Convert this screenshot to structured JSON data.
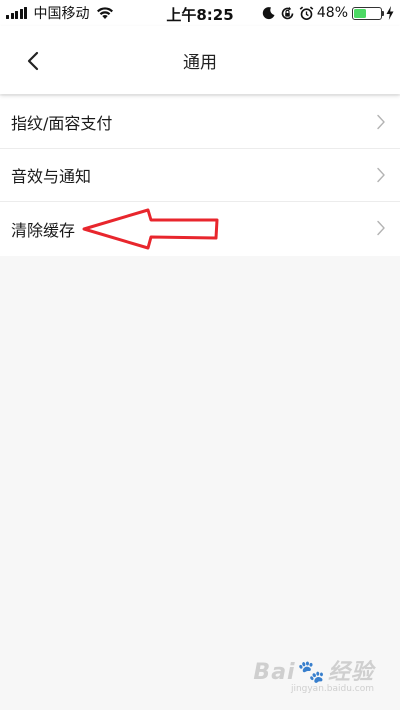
{
  "status_bar": {
    "carrier": "中国移动",
    "time": "上午8:25",
    "battery_percent": "48%",
    "battery_level": 0.48,
    "icons": [
      "signal-bars-icon",
      "wifi-icon",
      "moon-icon",
      "rotation-lock-icon",
      "alarm-icon",
      "battery-icon",
      "charging-bolt-icon"
    ]
  },
  "nav": {
    "title": "通用",
    "back_icon": "chevron-left-icon"
  },
  "list": {
    "items": [
      {
        "label": "指纹/面容支付",
        "icon": "chevron-right-icon"
      },
      {
        "label": "音效与通知",
        "icon": "chevron-right-icon"
      },
      {
        "label": "清除缓存",
        "icon": "chevron-right-icon"
      }
    ]
  },
  "annotation": {
    "arrow_color": "#e8262d"
  },
  "watermark": {
    "brand_left": "Bai",
    "brand_right": "经验",
    "url": "jingyan.baidu.com"
  },
  "colors": {
    "background": "#f7f7f7",
    "surface": "#ffffff",
    "battery_fill": "#4cd964"
  }
}
